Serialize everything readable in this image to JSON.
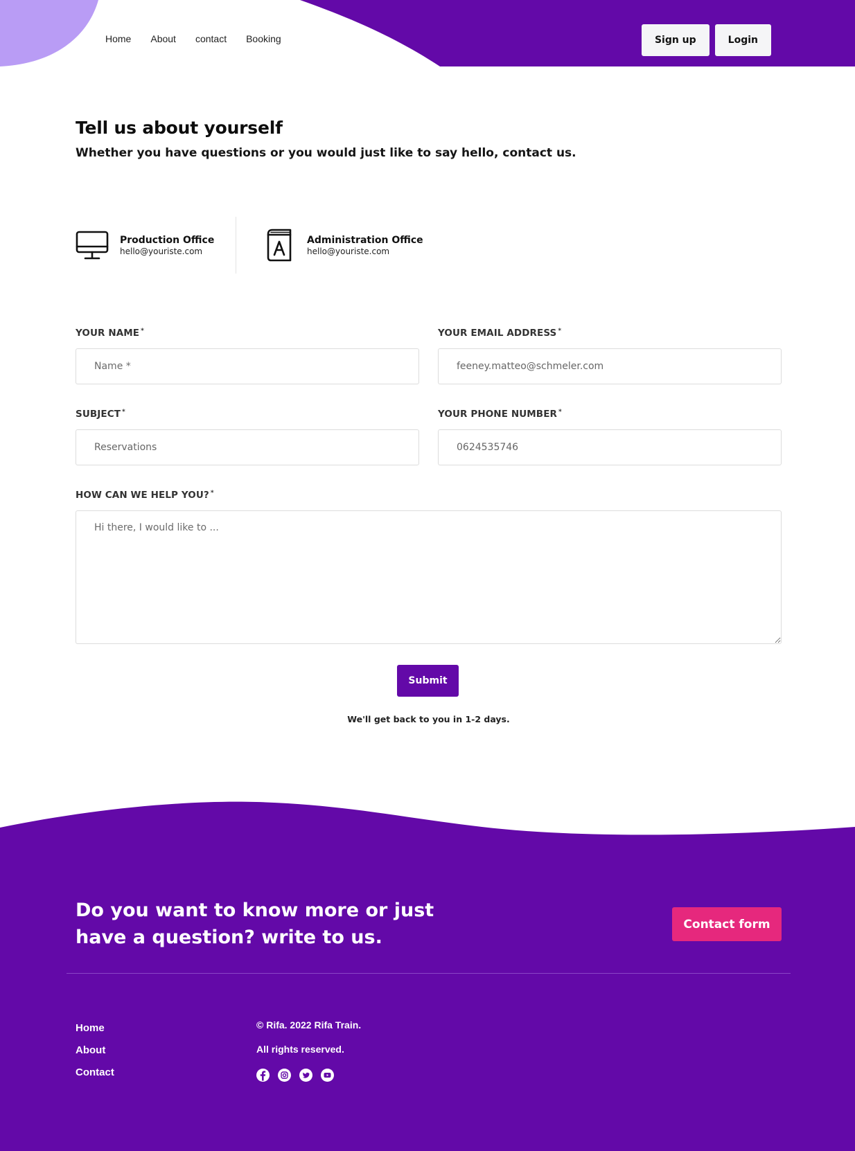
{
  "nav": {
    "items": [
      "Home",
      "About",
      "contact",
      "Booking"
    ],
    "signup_label": "Sign up",
    "login_label": "Login"
  },
  "intro": {
    "title": "Tell us about yourself",
    "subtitle": "Whether you have questions or you would just like to say hello, contact us."
  },
  "offices": [
    {
      "title": "Production Office",
      "email": "hello@youriste.com",
      "icon": "monitor-icon"
    },
    {
      "title": "Administration Office",
      "email": "hello@youriste.com",
      "icon": "address-book-icon"
    }
  ],
  "form": {
    "name_label": "YOUR NAME",
    "name_placeholder": "Name *",
    "email_label": "YOUR EMAIL ADDRESS",
    "email_value": "feeney.matteo@schmeler.com",
    "subject_label": "SUBJECT",
    "subject_value": "Reservations",
    "phone_label": "YOUR PHONE NUMBER",
    "phone_value": "0624535746",
    "message_label": "HOW CAN WE HELP YOU?",
    "message_placeholder": "Hi there, I would like to ...",
    "required_mark": "*",
    "submit_label": "Submit",
    "note": "We'll get back to you in 1-2 days."
  },
  "footer": {
    "cta_title": "Do you want to know more or just have a question? write to us.",
    "cta_button": "Contact form",
    "links": [
      "Home",
      "About",
      "Contact"
    ],
    "copyright": "© Rifa. 2022 Rifa Train.",
    "rights": "All rights reserved.",
    "socials": [
      "facebook-icon",
      "instagram-icon",
      "twitter-icon",
      "youtube-icon"
    ]
  },
  "colors": {
    "brand_purple": "#6309a8",
    "light_purple": "#b99cf5",
    "accent_pink": "#e6287d"
  }
}
